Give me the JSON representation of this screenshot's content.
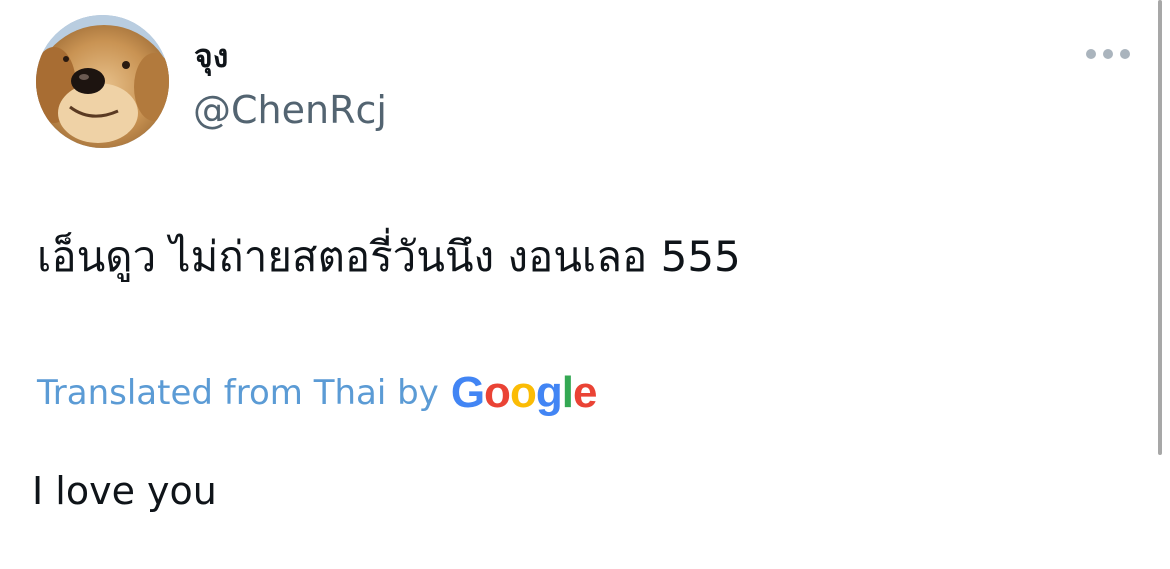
{
  "tweet": {
    "display_name": "จุง",
    "handle": "@ChenRcj",
    "avatar_icon": "dog-avatar-icon",
    "more_icon": "more-options-icon",
    "text": "เอ็นดูว ไม่ถ่ายสตอรี่วันนึง งอนเลอ 555",
    "translation": {
      "label": "Translated from Thai by",
      "provider": {
        "letters": [
          "G",
          "o",
          "o",
          "g",
          "l",
          "e"
        ],
        "colors": [
          "#4285f4",
          "#ea4335",
          "#fbbc05",
          "#4285f4",
          "#34a853",
          "#ea4335"
        ]
      },
      "label_color": "#5b9bd5",
      "text": "I love you"
    }
  }
}
